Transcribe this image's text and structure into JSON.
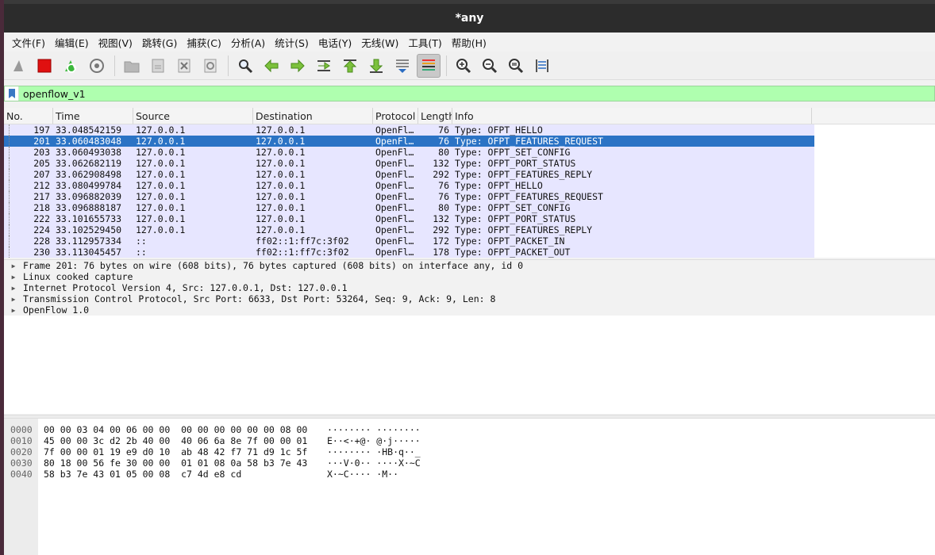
{
  "window": {
    "title": "*any"
  },
  "menu": [
    "文件(F)",
    "编辑(E)",
    "视图(V)",
    "跳转(G)",
    "捕获(C)",
    "分析(A)",
    "统计(S)",
    "电话(Y)",
    "无线(W)",
    "工具(T)",
    "帮助(H)"
  ],
  "toolbar": [
    {
      "name": "start-capture-icon"
    },
    {
      "name": "stop-capture-icon"
    },
    {
      "name": "restart-capture-icon"
    },
    {
      "name": "capture-options-icon"
    },
    {
      "sep": true
    },
    {
      "name": "open-file-icon"
    },
    {
      "name": "save-file-icon"
    },
    {
      "name": "close-file-icon"
    },
    {
      "name": "reload-file-icon"
    },
    {
      "sep": true
    },
    {
      "name": "find-packet-icon"
    },
    {
      "name": "go-back-icon"
    },
    {
      "name": "go-forward-icon"
    },
    {
      "name": "go-to-packet-icon"
    },
    {
      "name": "go-first-icon"
    },
    {
      "name": "go-last-icon"
    },
    {
      "name": "auto-scroll-icon"
    },
    {
      "name": "colorize-icon",
      "active": true
    },
    {
      "sep": true
    },
    {
      "name": "zoom-in-icon"
    },
    {
      "name": "zoom-out-icon"
    },
    {
      "name": "zoom-normal-icon"
    },
    {
      "name": "resize-columns-icon"
    }
  ],
  "filter": {
    "value": "openflow_v1"
  },
  "packet_list": {
    "columns": [
      "No.",
      "Time",
      "Source",
      "Destination",
      "Protocol",
      "Length",
      "Info"
    ],
    "rows": [
      {
        "no": "197",
        "time": "33.048542159",
        "src": "127.0.0.1",
        "dst": "127.0.0.1",
        "proto": "OpenFl…",
        "len": "76",
        "info": "Type: OFPT_HELLO"
      },
      {
        "no": "201",
        "time": "33.060483048",
        "src": "127.0.0.1",
        "dst": "127.0.0.1",
        "proto": "OpenFl…",
        "len": "76",
        "info": "Type: OFPT_FEATURES_REQUEST",
        "selected": true
      },
      {
        "no": "203",
        "time": "33.060493038",
        "src": "127.0.0.1",
        "dst": "127.0.0.1",
        "proto": "OpenFl…",
        "len": "80",
        "info": "Type: OFPT_SET_CONFIG"
      },
      {
        "no": "205",
        "time": "33.062682119",
        "src": "127.0.0.1",
        "dst": "127.0.0.1",
        "proto": "OpenFl…",
        "len": "132",
        "info": "Type: OFPT_PORT_STATUS"
      },
      {
        "no": "207",
        "time": "33.062908498",
        "src": "127.0.0.1",
        "dst": "127.0.0.1",
        "proto": "OpenFl…",
        "len": "292",
        "info": "Type: OFPT_FEATURES_REPLY"
      },
      {
        "no": "212",
        "time": "33.080499784",
        "src": "127.0.0.1",
        "dst": "127.0.0.1",
        "proto": "OpenFl…",
        "len": "76",
        "info": "Type: OFPT_HELLO"
      },
      {
        "no": "217",
        "time": "33.096882039",
        "src": "127.0.0.1",
        "dst": "127.0.0.1",
        "proto": "OpenFl…",
        "len": "76",
        "info": "Type: OFPT_FEATURES_REQUEST"
      },
      {
        "no": "218",
        "time": "33.096888187",
        "src": "127.0.0.1",
        "dst": "127.0.0.1",
        "proto": "OpenFl…",
        "len": "80",
        "info": "Type: OFPT_SET_CONFIG"
      },
      {
        "no": "222",
        "time": "33.101655733",
        "src": "127.0.0.1",
        "dst": "127.0.0.1",
        "proto": "OpenFl…",
        "len": "132",
        "info": "Type: OFPT_PORT_STATUS"
      },
      {
        "no": "224",
        "time": "33.102529450",
        "src": "127.0.0.1",
        "dst": "127.0.0.1",
        "proto": "OpenFl…",
        "len": "292",
        "info": "Type: OFPT_FEATURES_REPLY"
      },
      {
        "no": "228",
        "time": "33.112957334",
        "src": "::",
        "dst": "ff02::1:ff7c:3f02",
        "proto": "OpenFl…",
        "len": "172",
        "info": "Type: OFPT_PACKET_IN"
      },
      {
        "no": "230",
        "time": "33.113045457",
        "src": "::",
        "dst": "ff02::1:ff7c:3f02",
        "proto": "OpenFl…",
        "len": "178",
        "info": "Type: OFPT_PACKET_OUT"
      }
    ]
  },
  "details": [
    "Frame 201: 76 bytes on wire (608 bits), 76 bytes captured (608 bits) on interface any, id 0",
    "Linux cooked capture",
    "Internet Protocol Version 4, Src: 127.0.0.1, Dst: 127.0.0.1",
    "Transmission Control Protocol, Src Port: 6633, Dst Port: 53264, Seq: 9, Ack: 9, Len: 8",
    "OpenFlow 1.0"
  ],
  "bytes": [
    {
      "off": "0000",
      "hex": "00 00 03 04 00 06 00 00  00 00 00 00 00 00 08 00",
      "ascii": "········ ········"
    },
    {
      "off": "0010",
      "hex": "45 00 00 3c d2 2b 40 00  40 06 6a 8e 7f 00 00 01",
      "ascii": "E··<·+@· @·j·····"
    },
    {
      "off": "0020",
      "hex": "7f 00 00 01 19 e9 d0 10  ab 48 42 f7 71 d9 1c 5f",
      "ascii": "········ ·HB·q··_"
    },
    {
      "off": "0030",
      "hex": "80 18 00 56 fe 30 00 00  01 01 08 0a 58 b3 7e 43",
      "ascii": "···V·0·· ····X·~C"
    },
    {
      "off": "0040",
      "hex": "58 b3 7e 43 01 05 00 08  c7 4d e8 cd",
      "ascii": "X·~C···· ·M··"
    }
  ],
  "colors": {
    "filter_bg": "#afffaf",
    "row_bg": "#e7e6ff",
    "selected_bg": "#2b73c5"
  }
}
